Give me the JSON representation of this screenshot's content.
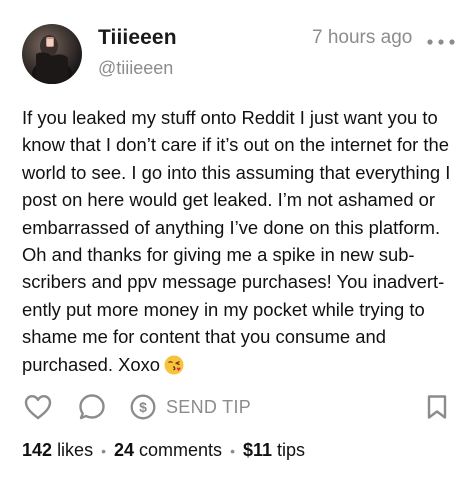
{
  "post": {
    "author_name": "Tiiieeen",
    "author_handle": "@tiiieeen",
    "timestamp": "7 hours ago",
    "more_icon": "more-horizontal-icon",
    "text": "If you leaked my stuff onto Reddit I just want you to know that I don’t care if it’s out on the internet for the world to see. I go into this assuming that everything I post on here would get leaked. I’m not ashamed or embarrassed of anything I’ve done on this platform. Oh and thanks for giving me a spike in new sub-scribers and ppv message purchases! You inadvert-ently put more money in my pocket while trying to shame me for content that you consume and purchased. Xoxo",
    "emoji": "kissing-face-emoji"
  },
  "actions": {
    "like_icon": "heart-icon",
    "comment_icon": "comment-icon",
    "tip_icon": "dollar-circle-icon",
    "tip_label": "SEND TIP",
    "bookmark_icon": "bookmark-icon"
  },
  "stats": {
    "likes_count": "142",
    "likes_label": "likes",
    "comments_count": "24",
    "comments_label": "comments",
    "tips_amount": "$11",
    "tips_label": "tips",
    "separator": "•"
  },
  "colors": {
    "text": "#111111",
    "muted": "#8c8c8c",
    "icon": "#8c8c8c",
    "background": "#ffffff"
  }
}
